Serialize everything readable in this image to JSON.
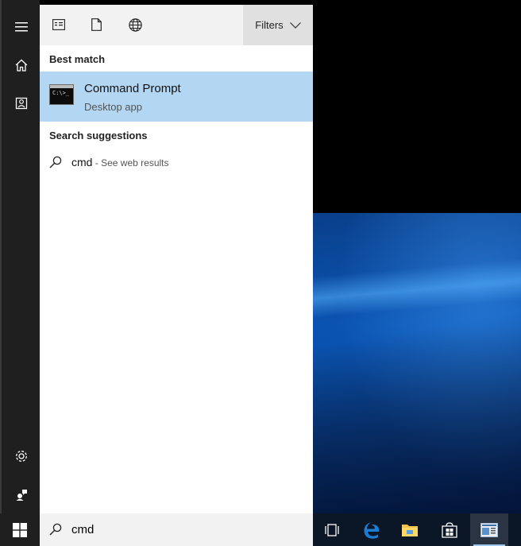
{
  "topbar": {
    "icons": [
      "apps-icon",
      "documents-icon",
      "web-icon"
    ],
    "filters_label": "Filters"
  },
  "best_match": {
    "heading": "Best match",
    "title": "Command Prompt",
    "subtitle": "Desktop app",
    "icon_text": "C:\\>_"
  },
  "suggestions": {
    "heading": "Search suggestions",
    "items": [
      {
        "query": "cmd",
        "hint": " - See web results"
      }
    ]
  },
  "search": {
    "value": "cmd"
  },
  "rail": {
    "items": [
      "hamburger-icon",
      "home-icon",
      "device-icon",
      "settings-icon",
      "feedback-icon"
    ]
  },
  "taskbar": {
    "apps": [
      "task-view-icon",
      "edge-icon",
      "file-explorer-icon",
      "store-icon",
      "active-app-icon"
    ]
  },
  "colors": {
    "accent_selected": "#b3d6f2",
    "rail_bg": "#1f1f1f",
    "taskbar_bg": "#0b1626",
    "edge_blue": "#1a7fd4"
  }
}
